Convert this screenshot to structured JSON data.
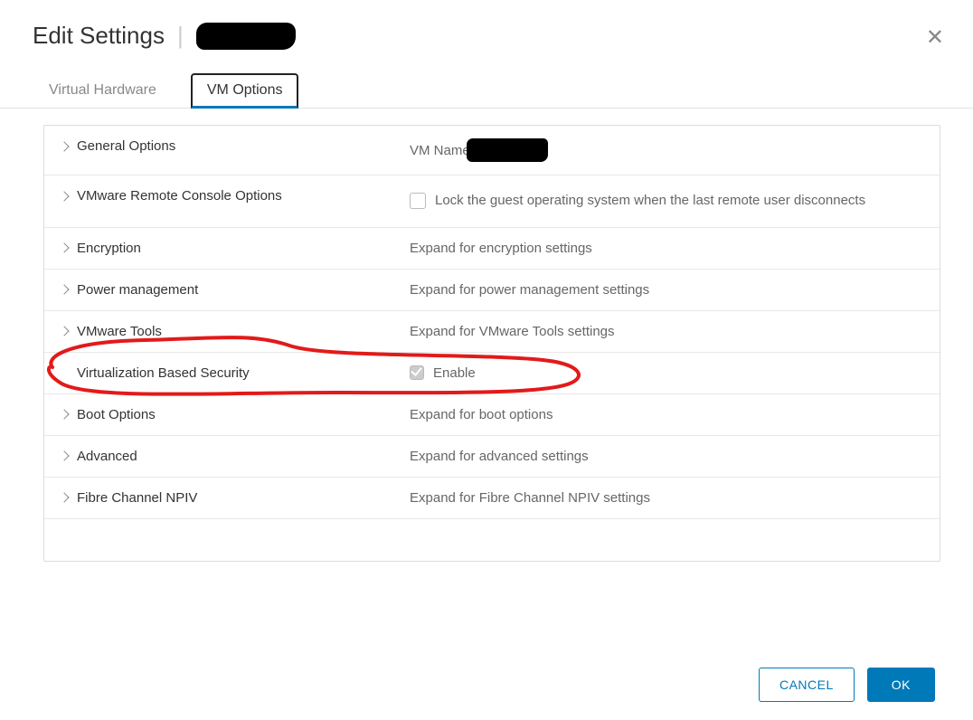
{
  "header": {
    "title": "Edit Settings"
  },
  "tabs": {
    "hardware": "Virtual Hardware",
    "options": "VM Options"
  },
  "rows": {
    "general": {
      "label": "General Options",
      "value_prefix": "VM Name:"
    },
    "remote_console": {
      "label": "VMware Remote Console Options",
      "checkbox_text": "Lock the guest operating system when the last remote user disconnects"
    },
    "encryption": {
      "label": "Encryption",
      "value": "Expand for encryption settings"
    },
    "power": {
      "label": "Power management",
      "value": "Expand for power management settings"
    },
    "tools": {
      "label": "VMware Tools",
      "value": "Expand for VMware Tools settings"
    },
    "vbs": {
      "label": "Virtualization Based Security",
      "checkbox_text": "Enable"
    },
    "boot": {
      "label": "Boot Options",
      "value": "Expand for boot options"
    },
    "advanced": {
      "label": "Advanced",
      "value": "Expand for advanced settings"
    },
    "npiv": {
      "label": "Fibre Channel NPIV",
      "value": "Expand for Fibre Channel NPIV settings"
    }
  },
  "buttons": {
    "cancel": "CANCEL",
    "ok": "OK"
  }
}
